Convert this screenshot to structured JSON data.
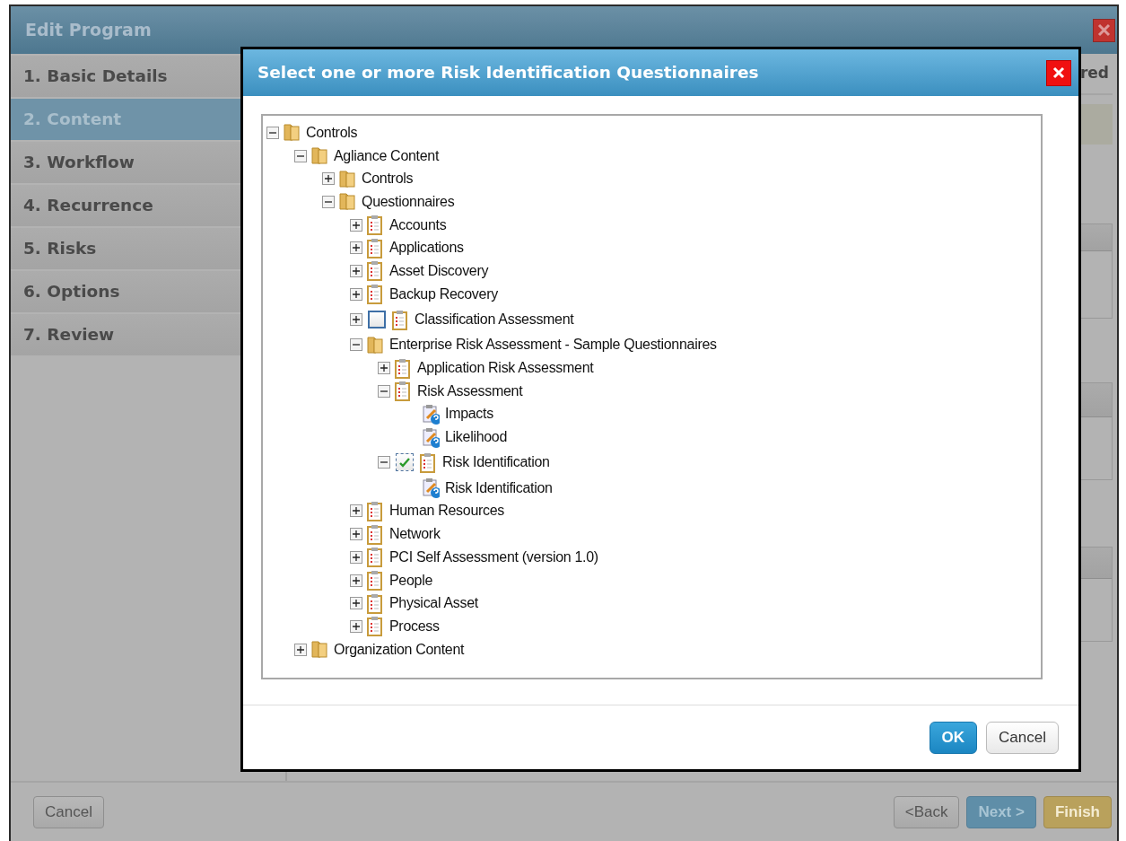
{
  "window": {
    "title": "Edit Program"
  },
  "steps": [
    {
      "label": "1. Basic Details",
      "selected": false
    },
    {
      "label": "2. Content",
      "selected": true
    },
    {
      "label": "3. Workflow",
      "selected": false
    },
    {
      "label": "4. Recurrence",
      "selected": false
    },
    {
      "label": "5. Risks",
      "selected": false
    },
    {
      "label": "6. Options",
      "selected": false
    },
    {
      "label": "7. Review",
      "selected": false
    }
  ],
  "content": {
    "header_text": "red"
  },
  "dialog": {
    "title": "Select one or more Risk Identification Questionnaires",
    "tree": [
      {
        "label": "Controls",
        "kind": "folder",
        "expanded": true,
        "children": [
          {
            "label": "Agliance Content",
            "kind": "folder",
            "expanded": true,
            "children": [
              {
                "label": "Controls",
                "kind": "folder",
                "expanded": false
              },
              {
                "label": "Questionnaires",
                "kind": "folder",
                "expanded": true,
                "children": [
                  {
                    "label": "Accounts",
                    "kind": "questionnaire",
                    "expanded": false
                  },
                  {
                    "label": "Applications",
                    "kind": "questionnaire",
                    "expanded": false
                  },
                  {
                    "label": "Asset Discovery",
                    "kind": "questionnaire",
                    "expanded": false
                  },
                  {
                    "label": "Backup Recovery",
                    "kind": "questionnaire",
                    "expanded": false
                  },
                  {
                    "label": "Classification Assessment",
                    "kind": "questionnaire",
                    "expanded": false,
                    "checked": false
                  },
                  {
                    "label": "Enterprise Risk Assessment - Sample Questionnaires",
                    "kind": "folder",
                    "expanded": true,
                    "children": [
                      {
                        "label": "Application Risk Assessment",
                        "kind": "questionnaire",
                        "expanded": false
                      },
                      {
                        "label": "Risk Assessment",
                        "kind": "questionnaire",
                        "expanded": true,
                        "children": [
                          {
                            "label": "Impacts",
                            "kind": "question"
                          },
                          {
                            "label": "Likelihood",
                            "kind": "question"
                          }
                        ]
                      },
                      {
                        "label": "Risk Identification",
                        "kind": "questionnaire",
                        "expanded": true,
                        "checked": true,
                        "children": [
                          {
                            "label": "Risk Identification",
                            "kind": "question"
                          }
                        ]
                      }
                    ]
                  },
                  {
                    "label": "Human Resources",
                    "kind": "questionnaire",
                    "expanded": false
                  },
                  {
                    "label": "Network",
                    "kind": "questionnaire",
                    "expanded": false
                  },
                  {
                    "label": "PCI Self Assessment (version 1.0)",
                    "kind": "questionnaire",
                    "expanded": false
                  },
                  {
                    "label": "People",
                    "kind": "questionnaire",
                    "expanded": false
                  },
                  {
                    "label": "Physical Asset",
                    "kind": "questionnaire",
                    "expanded": false
                  },
                  {
                    "label": "Process",
                    "kind": "questionnaire",
                    "expanded": false
                  }
                ]
              }
            ]
          },
          {
            "label": "Organization Content",
            "kind": "folder",
            "expanded": false
          }
        ]
      }
    ],
    "buttons": [
      {
        "label": "OK",
        "kind": "primary"
      },
      {
        "label": "Cancel",
        "kind": "default"
      }
    ]
  },
  "footer": {
    "left_buttons": [
      {
        "label": "Cancel",
        "kind": "default"
      }
    ],
    "right_buttons": [
      {
        "label": "<Back",
        "kind": "default"
      },
      {
        "label": "Next >",
        "kind": "next"
      },
      {
        "label": "Finish",
        "kind": "finish"
      }
    ]
  }
}
